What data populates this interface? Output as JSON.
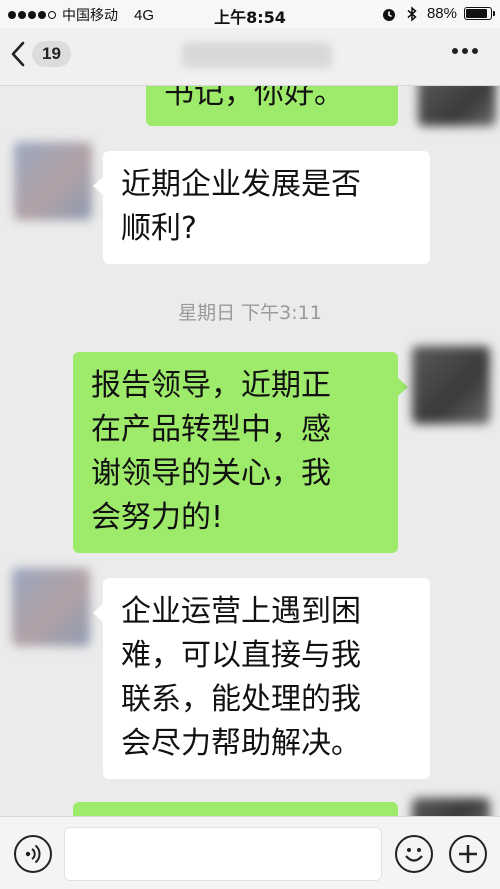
{
  "status_bar": {
    "carrier": "中国移动",
    "network": "4G",
    "time": "上午8:54",
    "battery": "88%",
    "battery_level": 0.88,
    "icons": [
      "signal-dots-icon",
      "alarm-icon",
      "bluetooth-icon",
      "battery-icon"
    ]
  },
  "nav": {
    "unread_count": "19",
    "icons": [
      "back-chevron-icon",
      "more-dots-icon"
    ]
  },
  "messages": [
    {
      "sender": "me",
      "text_lines": [
        "书记，你好。"
      ]
    },
    {
      "sender": "other",
      "text_lines": [
        "近期企业发展是否",
        "顺利?"
      ]
    },
    {
      "sender": "me",
      "text_lines": [
        "报告领导，近期正",
        "在产品转型中，感",
        "谢领导的关心，我",
        "会努力的!"
      ]
    },
    {
      "sender": "other",
      "text_lines": [
        "企业运营上遇到困",
        "难，可以直接与我",
        "联系，能处理的我",
        "会尽力帮助解决。"
      ]
    }
  ],
  "timestamp": "星期日 下午3:11",
  "input_bar": {
    "placeholder": "",
    "icons": [
      "voice-icon",
      "emoji-icon",
      "plus-icon"
    ]
  },
  "colors": {
    "my_bubble": "#9eea6a",
    "other_bubble": "#ffffff",
    "chat_background": "#ebebeb"
  }
}
